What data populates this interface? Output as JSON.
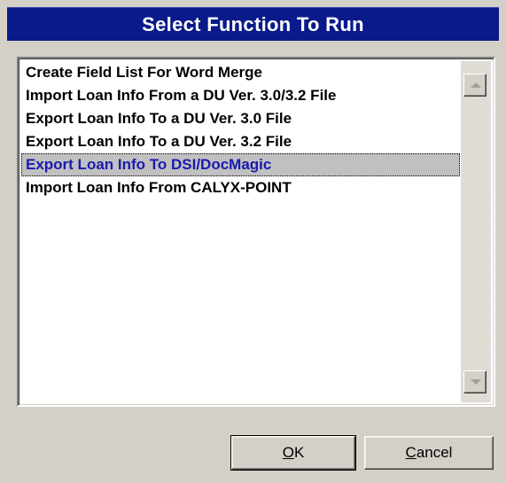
{
  "dialog": {
    "title": "Select Function To Run"
  },
  "list": {
    "items": [
      {
        "label": "Create Field List For Word Merge",
        "selected": false
      },
      {
        "label": "Import Loan Info From a DU Ver. 3.0/3.2 File",
        "selected": false
      },
      {
        "label": "Export Loan Info To a DU Ver. 3.0 File",
        "selected": false
      },
      {
        "label": "Export Loan Info To a DU Ver. 3.2 File",
        "selected": false
      },
      {
        "label": "Export Loan Info To DSI/DocMagic",
        "selected": true
      },
      {
        "label": "Import Loan Info From CALYX-POINT",
        "selected": false
      }
    ],
    "selected_color": "#1a1ab0",
    "selected_background": "#c0c0c0"
  },
  "scrollbar": {
    "up_icon": "arrow-up-icon",
    "down_icon": "arrow-down-icon"
  },
  "buttons": {
    "ok": {
      "mnemonic": "O",
      "rest": "K"
    },
    "cancel": {
      "mnemonic": "C",
      "rest": "ancel"
    }
  },
  "colors": {
    "titlebar": "#0a1a8a",
    "face": "#d4d0c8"
  }
}
